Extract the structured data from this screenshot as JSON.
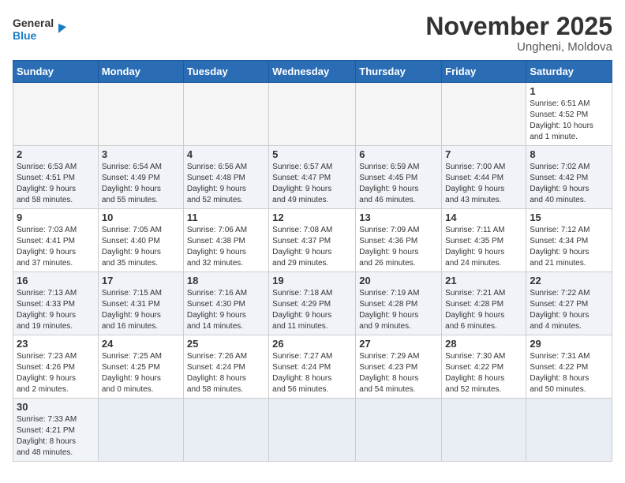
{
  "header": {
    "logo_general": "General",
    "logo_blue": "Blue",
    "month_title": "November 2025",
    "location": "Ungheni, Moldova"
  },
  "weekdays": [
    "Sunday",
    "Monday",
    "Tuesday",
    "Wednesday",
    "Thursday",
    "Friday",
    "Saturday"
  ],
  "weeks": [
    [
      {
        "day": "",
        "info": "",
        "empty": true
      },
      {
        "day": "",
        "info": "",
        "empty": true
      },
      {
        "day": "",
        "info": "",
        "empty": true
      },
      {
        "day": "",
        "info": "",
        "empty": true
      },
      {
        "day": "",
        "info": "",
        "empty": true
      },
      {
        "day": "",
        "info": "",
        "empty": true
      },
      {
        "day": "1",
        "info": "Sunrise: 6:51 AM\nSunset: 4:52 PM\nDaylight: 10 hours\nand 1 minute.",
        "empty": false
      }
    ],
    [
      {
        "day": "2",
        "info": "Sunrise: 6:53 AM\nSunset: 4:51 PM\nDaylight: 9 hours\nand 58 minutes.",
        "empty": false
      },
      {
        "day": "3",
        "info": "Sunrise: 6:54 AM\nSunset: 4:49 PM\nDaylight: 9 hours\nand 55 minutes.",
        "empty": false
      },
      {
        "day": "4",
        "info": "Sunrise: 6:56 AM\nSunset: 4:48 PM\nDaylight: 9 hours\nand 52 minutes.",
        "empty": false
      },
      {
        "day": "5",
        "info": "Sunrise: 6:57 AM\nSunset: 4:47 PM\nDaylight: 9 hours\nand 49 minutes.",
        "empty": false
      },
      {
        "day": "6",
        "info": "Sunrise: 6:59 AM\nSunset: 4:45 PM\nDaylight: 9 hours\nand 46 minutes.",
        "empty": false
      },
      {
        "day": "7",
        "info": "Sunrise: 7:00 AM\nSunset: 4:44 PM\nDaylight: 9 hours\nand 43 minutes.",
        "empty": false
      },
      {
        "day": "8",
        "info": "Sunrise: 7:02 AM\nSunset: 4:42 PM\nDaylight: 9 hours\nand 40 minutes.",
        "empty": false
      }
    ],
    [
      {
        "day": "9",
        "info": "Sunrise: 7:03 AM\nSunset: 4:41 PM\nDaylight: 9 hours\nand 37 minutes.",
        "empty": false
      },
      {
        "day": "10",
        "info": "Sunrise: 7:05 AM\nSunset: 4:40 PM\nDaylight: 9 hours\nand 35 minutes.",
        "empty": false
      },
      {
        "day": "11",
        "info": "Sunrise: 7:06 AM\nSunset: 4:38 PM\nDaylight: 9 hours\nand 32 minutes.",
        "empty": false
      },
      {
        "day": "12",
        "info": "Sunrise: 7:08 AM\nSunset: 4:37 PM\nDaylight: 9 hours\nand 29 minutes.",
        "empty": false
      },
      {
        "day": "13",
        "info": "Sunrise: 7:09 AM\nSunset: 4:36 PM\nDaylight: 9 hours\nand 26 minutes.",
        "empty": false
      },
      {
        "day": "14",
        "info": "Sunrise: 7:11 AM\nSunset: 4:35 PM\nDaylight: 9 hours\nand 24 minutes.",
        "empty": false
      },
      {
        "day": "15",
        "info": "Sunrise: 7:12 AM\nSunset: 4:34 PM\nDaylight: 9 hours\nand 21 minutes.",
        "empty": false
      }
    ],
    [
      {
        "day": "16",
        "info": "Sunrise: 7:13 AM\nSunset: 4:33 PM\nDaylight: 9 hours\nand 19 minutes.",
        "empty": false
      },
      {
        "day": "17",
        "info": "Sunrise: 7:15 AM\nSunset: 4:31 PM\nDaylight: 9 hours\nand 16 minutes.",
        "empty": false
      },
      {
        "day": "18",
        "info": "Sunrise: 7:16 AM\nSunset: 4:30 PM\nDaylight: 9 hours\nand 14 minutes.",
        "empty": false
      },
      {
        "day": "19",
        "info": "Sunrise: 7:18 AM\nSunset: 4:29 PM\nDaylight: 9 hours\nand 11 minutes.",
        "empty": false
      },
      {
        "day": "20",
        "info": "Sunrise: 7:19 AM\nSunset: 4:28 PM\nDaylight: 9 hours\nand 9 minutes.",
        "empty": false
      },
      {
        "day": "21",
        "info": "Sunrise: 7:21 AM\nSunset: 4:28 PM\nDaylight: 9 hours\nand 6 minutes.",
        "empty": false
      },
      {
        "day": "22",
        "info": "Sunrise: 7:22 AM\nSunset: 4:27 PM\nDaylight: 9 hours\nand 4 minutes.",
        "empty": false
      }
    ],
    [
      {
        "day": "23",
        "info": "Sunrise: 7:23 AM\nSunset: 4:26 PM\nDaylight: 9 hours\nand 2 minutes.",
        "empty": false
      },
      {
        "day": "24",
        "info": "Sunrise: 7:25 AM\nSunset: 4:25 PM\nDaylight: 9 hours\nand 0 minutes.",
        "empty": false
      },
      {
        "day": "25",
        "info": "Sunrise: 7:26 AM\nSunset: 4:24 PM\nDaylight: 8 hours\nand 58 minutes.",
        "empty": false
      },
      {
        "day": "26",
        "info": "Sunrise: 7:27 AM\nSunset: 4:24 PM\nDaylight: 8 hours\nand 56 minutes.",
        "empty": false
      },
      {
        "day": "27",
        "info": "Sunrise: 7:29 AM\nSunset: 4:23 PM\nDaylight: 8 hours\nand 54 minutes.",
        "empty": false
      },
      {
        "day": "28",
        "info": "Sunrise: 7:30 AM\nSunset: 4:22 PM\nDaylight: 8 hours\nand 52 minutes.",
        "empty": false
      },
      {
        "day": "29",
        "info": "Sunrise: 7:31 AM\nSunset: 4:22 PM\nDaylight: 8 hours\nand 50 minutes.",
        "empty": false
      }
    ],
    [
      {
        "day": "30",
        "info": "Sunrise: 7:33 AM\nSunset: 4:21 PM\nDaylight: 8 hours\nand 48 minutes.",
        "empty": false
      },
      {
        "day": "",
        "info": "",
        "empty": true
      },
      {
        "day": "",
        "info": "",
        "empty": true
      },
      {
        "day": "",
        "info": "",
        "empty": true
      },
      {
        "day": "",
        "info": "",
        "empty": true
      },
      {
        "day": "",
        "info": "",
        "empty": true
      },
      {
        "day": "",
        "info": "",
        "empty": true
      }
    ]
  ]
}
